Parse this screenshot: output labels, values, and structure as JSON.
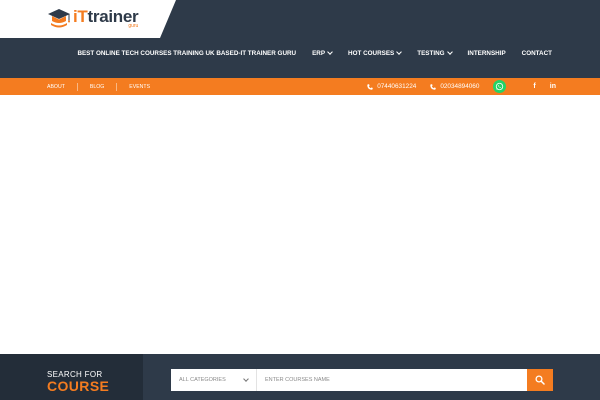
{
  "brand": {
    "name_accent": "iT",
    "name_rest": "trainer",
    "tagline": "guru",
    "accent_color": "#f47c20",
    "dark_color": "#2e3a49"
  },
  "nav": {
    "items": [
      {
        "label": "BEST ONLINE TECH COURSES TRAINING UK BASED-IT TRAINER GURU",
        "dropdown": false
      },
      {
        "label": "ERP",
        "dropdown": true
      },
      {
        "label": "HOT COURSES",
        "dropdown": true
      },
      {
        "label": "TESTING",
        "dropdown": true
      },
      {
        "label": "INTERNSHIP",
        "dropdown": false
      },
      {
        "label": "CONTACT",
        "dropdown": false
      }
    ]
  },
  "topbar": {
    "links": [
      "ABOUT",
      "BLOG",
      "EVENTS"
    ],
    "phone1": "07440631224",
    "phone2": "02034894060",
    "whatsapp_icon": "whatsapp-icon",
    "social": [
      "f",
      "in"
    ]
  },
  "search": {
    "label_top": "SEARCH FOR",
    "label_bottom": "COURSE",
    "category_selected": "ALL CATEGORIES",
    "input_placeholder": "ENTER COURSES NAME",
    "button_icon": "search-icon"
  }
}
